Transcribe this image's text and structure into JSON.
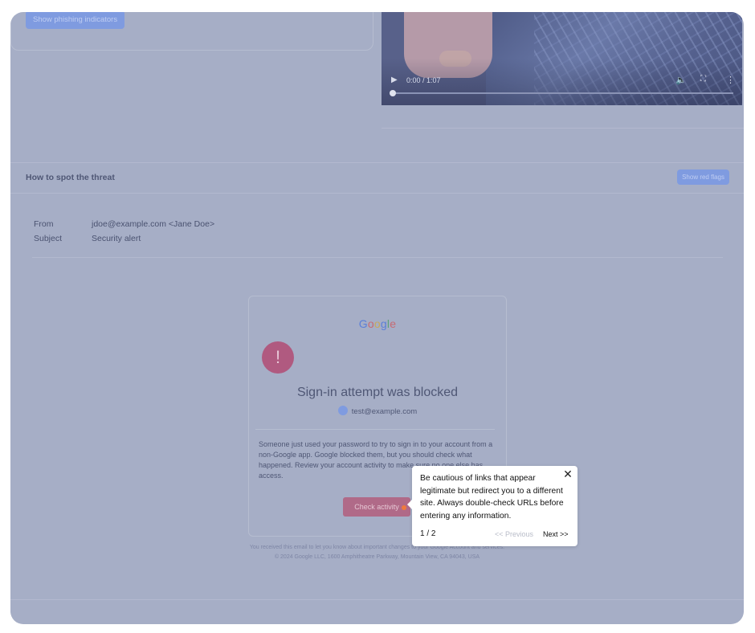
{
  "top": {
    "phishing_button": "Show phishing indicators"
  },
  "video": {
    "time": "0:00 / 1:07",
    "play_icon": "play-icon",
    "volume_icon": "volume-icon",
    "fullscreen_icon": "fullscreen-icon",
    "more_icon": "more-vertical-icon",
    "progress": 0.0
  },
  "threat": {
    "title": "How to spot the threat",
    "flags_button": "Show red flags"
  },
  "email_meta": {
    "from_label": "From",
    "from_value": "jdoe@example.com <Jane Doe>",
    "subject_label": "Subject",
    "subject_value": "Security alert"
  },
  "email": {
    "logo": [
      "G",
      "o",
      "o",
      "g",
      "l",
      "e"
    ],
    "logo_colors": [
      "#5a7fd8",
      "#c66a73",
      "#c9a95a",
      "#5a7fd8",
      "#5aa07a",
      "#c66a73"
    ],
    "alert_icon": "!",
    "title": "Sign-in attempt was blocked",
    "user": "test@example.com",
    "body": "Someone just used your password to try to sign in to your account from a non-Google app. Google blocked them, but you should check what happened. Review your account activity to make sure no one else has access.",
    "button": "Check activity",
    "footer_line1": "You received this email to let you know about important changes to your Google Account and services.",
    "footer_line2": "© 2024 Google LLC, 1600 Amphitheatre Parkway, Mountain View, CA 94043, USA"
  },
  "tooltip": {
    "text": "Be cautious of links that appear legitimate but redirect you to a different site. Always double-check URLs before entering any information.",
    "step": "1 / 2",
    "previous": "<< Previous",
    "next": "Next >>",
    "close_icon": "close-icon"
  },
  "colors": {
    "overlay": "#a6aec6",
    "accent_button": "#7f9be0",
    "danger": "#b05a80",
    "hotspot": "#f07a3c"
  }
}
